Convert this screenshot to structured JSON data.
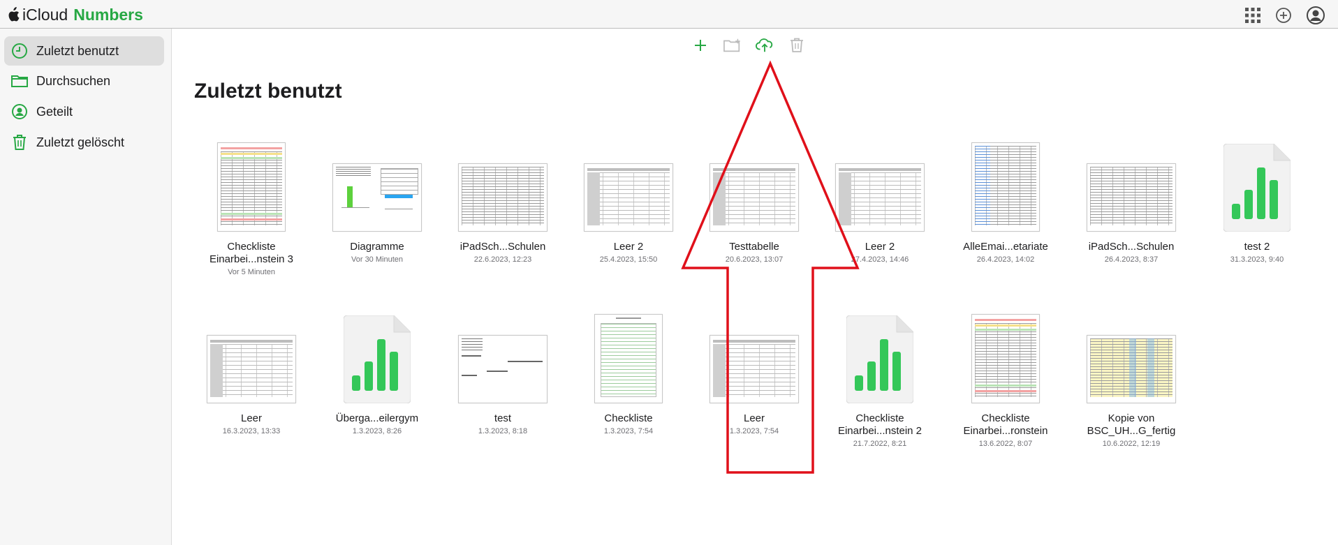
{
  "brand": {
    "icloud": "iCloud",
    "app": "Numbers"
  },
  "sidebar": {
    "items": [
      {
        "label": "Zuletzt benutzt",
        "icon": "clock-icon",
        "active": true
      },
      {
        "label": "Durchsuchen",
        "icon": "folder-icon",
        "active": false
      },
      {
        "label": "Geteilt",
        "icon": "shared-person-icon",
        "active": false
      },
      {
        "label": "Zuletzt gelöscht",
        "icon": "trash-icon",
        "active": false
      }
    ]
  },
  "main": {
    "title": "Zuletzt benutzt"
  },
  "colors": {
    "accent": "#27a844",
    "arrow": "#e0101a"
  },
  "files": [
    {
      "name": "Checkliste Einarbei...nstein 3",
      "date": "Vor 5 Minuten",
      "thumb": "portrait-colored"
    },
    {
      "name": "Diagramme",
      "date": "Vor 30 Minuten",
      "thumb": "landscape-chart"
    },
    {
      "name": "iPadSch...Schulen",
      "date": "22.6.2023, 12:23",
      "thumb": "landscape-dense"
    },
    {
      "name": "Leer 2",
      "date": "25.4.2023, 15:50",
      "thumb": "landscape-grey"
    },
    {
      "name": "Testtabelle",
      "date": "20.6.2023, 13:07",
      "thumb": "landscape-grey"
    },
    {
      "name": "Leer 2",
      "date": "27.4.2023, 14:46",
      "thumb": "landscape-grey"
    },
    {
      "name": "AlleEmai...etariate",
      "date": "26.4.2023, 14:02",
      "thumb": "portrait-blue"
    },
    {
      "name": "iPadSch...Schulen",
      "date": "26.4.2023, 8:37",
      "thumb": "landscape-dense"
    },
    {
      "name": "test 2",
      "date": "31.3.2023, 9:40",
      "thumb": "numbers-file"
    },
    {
      "name": "Leer",
      "date": "16.3.2023, 13:33",
      "thumb": "landscape-grey"
    },
    {
      "name": "Überga...eilergym",
      "date": "1.3.2023, 8:26",
      "thumb": "numbers-file"
    },
    {
      "name": "test",
      "date": "1.3.2023, 8:18",
      "thumb": "landscape-sparse"
    },
    {
      "name": "Checkliste",
      "date": "1.3.2023, 7:54",
      "thumb": "portrait-plain"
    },
    {
      "name": "Leer",
      "date": "1.3.2023, 7:54",
      "thumb": "landscape-grey"
    },
    {
      "name": "Checkliste Einarbei...nstein 2",
      "date": "21.7.2022, 8:21",
      "thumb": "numbers-file"
    },
    {
      "name": "Checkliste Einarbei...ronstein",
      "date": "13.6.2022, 8:07",
      "thumb": "portrait-colored"
    },
    {
      "name": "Kopie von BSC_UH...G_fertig",
      "date": "10.6.2022, 12:19",
      "thumb": "landscape-yellow"
    }
  ]
}
